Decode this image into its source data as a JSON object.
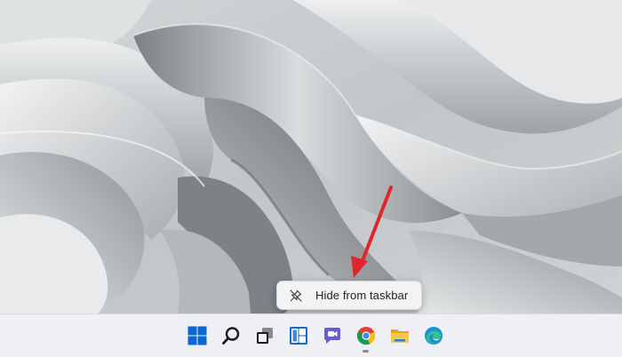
{
  "screen": {
    "wallpaper_name": "windows-11-bloom-wallpaper",
    "colors": {
      "wallpaper_light": "#e4e6e7",
      "wallpaper_dark": "#6a6f72",
      "taskbar_bg": "#eef0f3",
      "menu_bg": "#f3f3f3",
      "arrow": "#e0262b",
      "windows_blue": "#0b67d3"
    }
  },
  "context_menu": {
    "items": [
      {
        "label": "Hide from taskbar",
        "icon": "unpin-icon"
      }
    ]
  },
  "taskbar": {
    "icons": [
      {
        "name": "start-icon"
      },
      {
        "name": "search-icon"
      },
      {
        "name": "task-view-icon"
      },
      {
        "name": "widgets-icon"
      },
      {
        "name": "chat-icon"
      },
      {
        "name": "chrome-icon",
        "running": true
      },
      {
        "name": "file-explorer-icon"
      },
      {
        "name": "edge-icon"
      }
    ]
  }
}
